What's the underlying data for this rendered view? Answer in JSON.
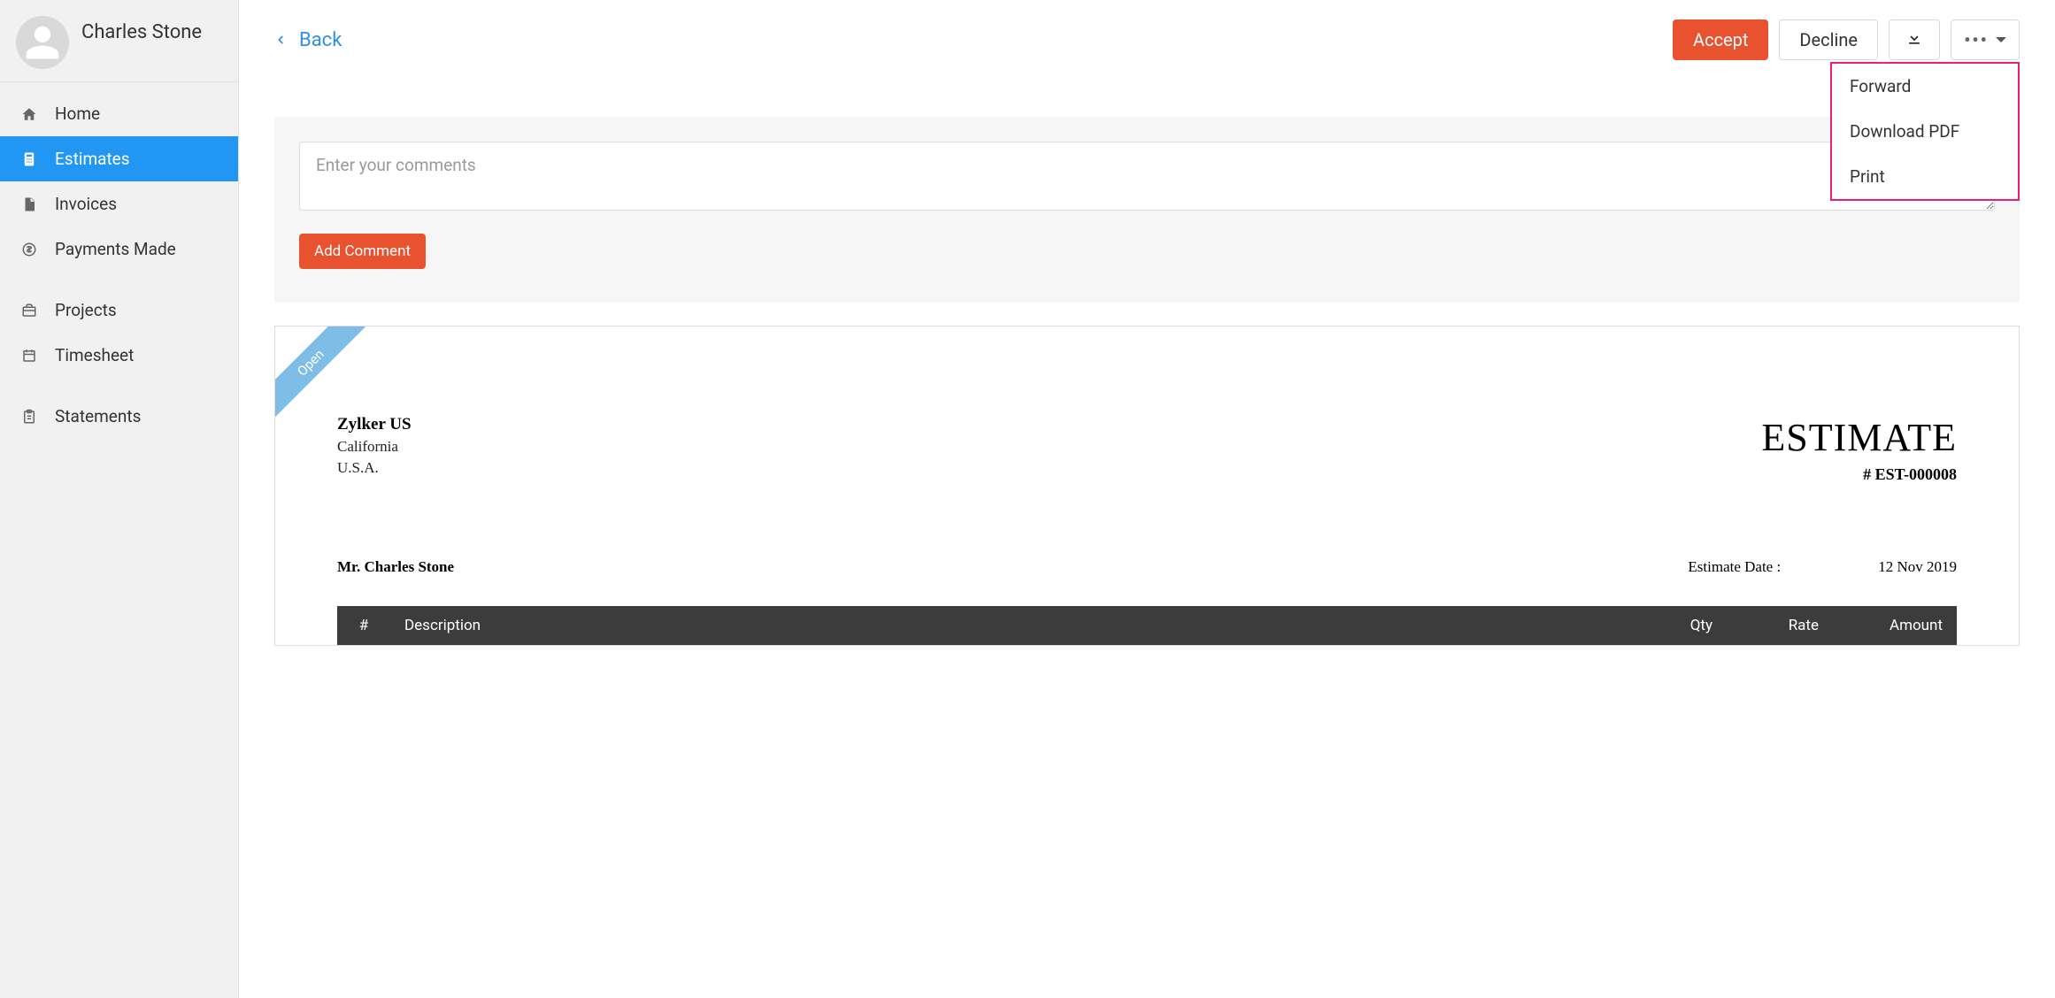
{
  "profile": {
    "name": "Charles Stone"
  },
  "sidebar": {
    "items": [
      {
        "label": "Home"
      },
      {
        "label": "Estimates"
      },
      {
        "label": "Invoices"
      },
      {
        "label": "Payments Made"
      },
      {
        "label": "Projects"
      },
      {
        "label": "Timesheet"
      },
      {
        "label": "Statements"
      }
    ]
  },
  "topbar": {
    "back": "Back",
    "accept": "Accept",
    "decline": "Decline"
  },
  "dropdown": {
    "forward": "Forward",
    "download_pdf": "Download PDF",
    "print": "Print"
  },
  "comments": {
    "placeholder": "Enter your comments",
    "add_button": "Add Comment"
  },
  "document": {
    "ribbon": "Open",
    "company": {
      "name": "Zylker US",
      "line1": "California",
      "line2": "U.S.A."
    },
    "title": "ESTIMATE",
    "number": "# EST-000008",
    "bill_to": "Mr. Charles Stone",
    "date_label": "Estimate Date :",
    "date_value": "12 Nov 2019",
    "columns": {
      "num": "#",
      "description": "Description",
      "qty": "Qty",
      "rate": "Rate",
      "amount": "Amount"
    }
  }
}
